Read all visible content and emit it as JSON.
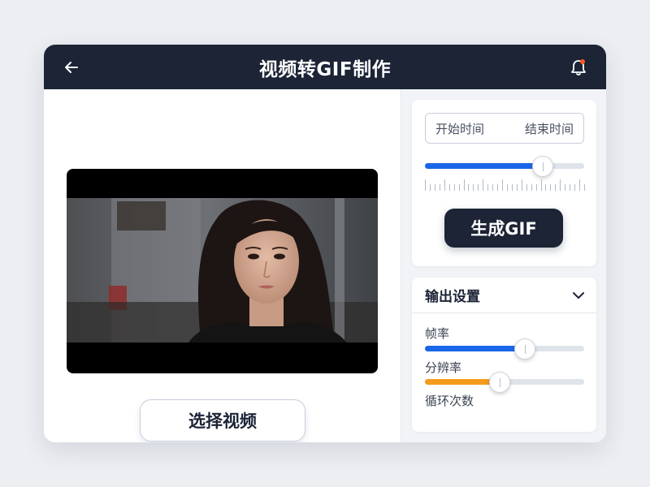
{
  "header": {
    "title": "视频转GIF制作",
    "back_icon": "arrow-left-icon",
    "notification_icon": "bell-icon",
    "notification_dot_color": "#ff5a1f"
  },
  "video": {
    "select_button_label": "选择视频"
  },
  "trim": {
    "start_label": "开始时间",
    "end_label": "结束时间",
    "position_fraction": 0.74,
    "accent_color": "#1a66e8"
  },
  "generate": {
    "label": "生成GIF"
  },
  "output_settings": {
    "title": "输出设置",
    "expand_icon": "chevron-down-icon",
    "items": [
      {
        "label": "帧率",
        "value_fraction": 0.63,
        "color": "#1a66e8"
      },
      {
        "label": "分辨率",
        "value_fraction": 0.47,
        "color": "#f59a1b"
      },
      {
        "label": "循环次数"
      }
    ]
  }
}
